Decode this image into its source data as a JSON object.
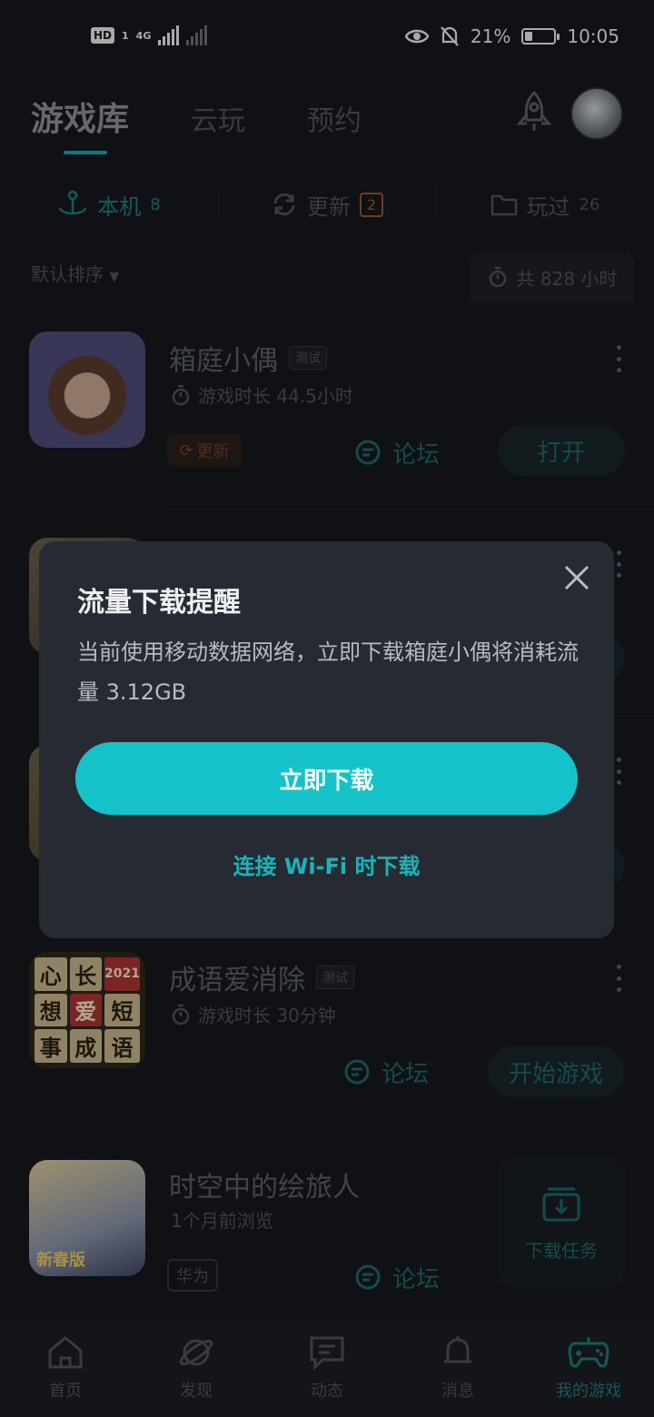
{
  "status_bar": {
    "hd": "HD",
    "sim": "1",
    "network": "4G",
    "battery": "21%",
    "time": "10:05"
  },
  "header": {
    "tabs": [
      {
        "label": "游戏库",
        "active": true
      },
      {
        "label": "云玩",
        "active": false
      },
      {
        "label": "预约",
        "active": false
      }
    ]
  },
  "sub_tabs": [
    {
      "label": "本机",
      "count": "8",
      "active": true
    },
    {
      "label": "更新",
      "badge": "2",
      "active": false
    },
    {
      "label": "玩过",
      "count": "26",
      "active": false
    }
  ],
  "sort": {
    "label": "默认排序",
    "total": "共 828 小时"
  },
  "games": [
    {
      "title": "箱庭小偶",
      "tag": "测试",
      "meta": "游戏时长 44.5小时",
      "update_chip": "更新",
      "forum": "论坛",
      "action": "打开"
    },
    {
      "title": "成语爱消除",
      "tag": "测试",
      "meta": "游戏时长 30分钟",
      "forum": "论坛",
      "action": "开始游戏",
      "icon_chars": [
        "心",
        "长",
        "",
        "想",
        "爱",
        "短",
        "事",
        "成",
        "语"
      ],
      "icon_ribbon": "2021"
    },
    {
      "title": "时空中的绘旅人",
      "meta": "1个月前浏览",
      "platform_chip": "华为",
      "forum": "论坛",
      "icon_caption": "新春版"
    }
  ],
  "download_task": {
    "label": "下载任务"
  },
  "bottom_nav": [
    {
      "label": "首页",
      "icon": "home-icon",
      "active": false
    },
    {
      "label": "发现",
      "icon": "planet-icon",
      "active": false
    },
    {
      "label": "动态",
      "icon": "chat-icon",
      "active": false
    },
    {
      "label": "消息",
      "icon": "bell-icon",
      "active": false
    },
    {
      "label": "我的游戏",
      "icon": "gamepad-icon",
      "active": true
    }
  ],
  "dialog": {
    "title": "流量下载提醒",
    "body": "当前使用移动数据网络，立即下载箱庭小偶将消耗流量 3.12GB",
    "primary": "立即下载",
    "secondary": "连接 Wi-Fi 时下载"
  },
  "colors": {
    "accent": "#16c2c9",
    "dialog_bg": "#262a33",
    "page_bg": "#15181c"
  }
}
